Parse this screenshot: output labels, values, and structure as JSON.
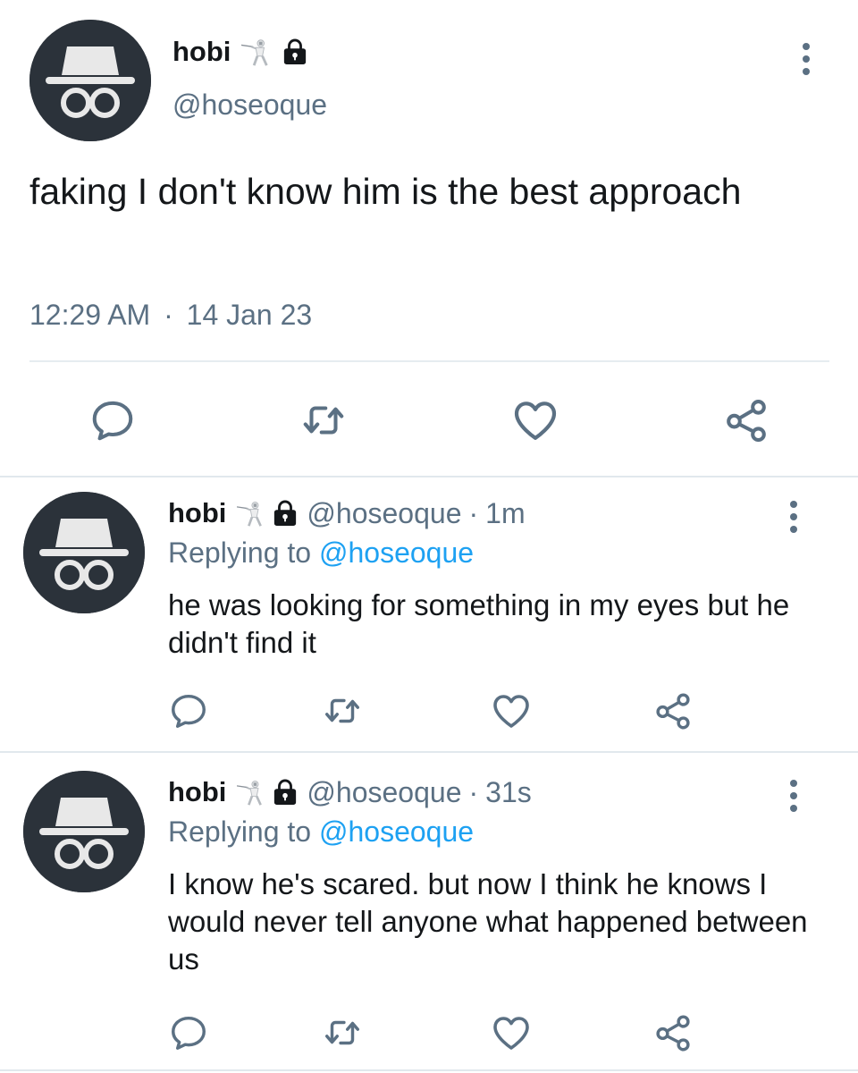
{
  "main_tweet": {
    "author_name": "hobi",
    "author_handle": "@hoseoque",
    "text": "faking I don't know him is the best approach",
    "time": "12:29 AM",
    "separator": "·",
    "date": "14 Jan 23"
  },
  "replies": [
    {
      "author_name": "hobi",
      "author_handle": "@hoseoque",
      "separator": "·",
      "relative_time": "1m",
      "replying_prefix": "Replying to ",
      "replying_to": "@hoseoque",
      "text": "he was looking for something in my eyes but he didn't find it"
    },
    {
      "author_name": "hobi",
      "author_handle": "@hoseoque",
      "separator": "·",
      "relative_time": "31s",
      "replying_prefix": "Replying to ",
      "replying_to": "@hoseoque",
      "text": "I know he's scared. but now I think he knows I would never tell anyone what happened between us"
    }
  ],
  "icons": {
    "avatar": "incognito-hat-glasses-icon",
    "badge_1": "fencer-emoji-icon",
    "badge_2": "lock-icon",
    "more": "vertical-ellipsis-icon",
    "actions": [
      "reply-icon",
      "retweet-icon",
      "like-icon",
      "share-icon"
    ]
  },
  "colors": {
    "text_primary": "#14171a",
    "text_secondary": "#5b7083",
    "mention": "#1da1f2",
    "avatar_bg": "#2b323a",
    "divider": "#e6ecf0"
  }
}
